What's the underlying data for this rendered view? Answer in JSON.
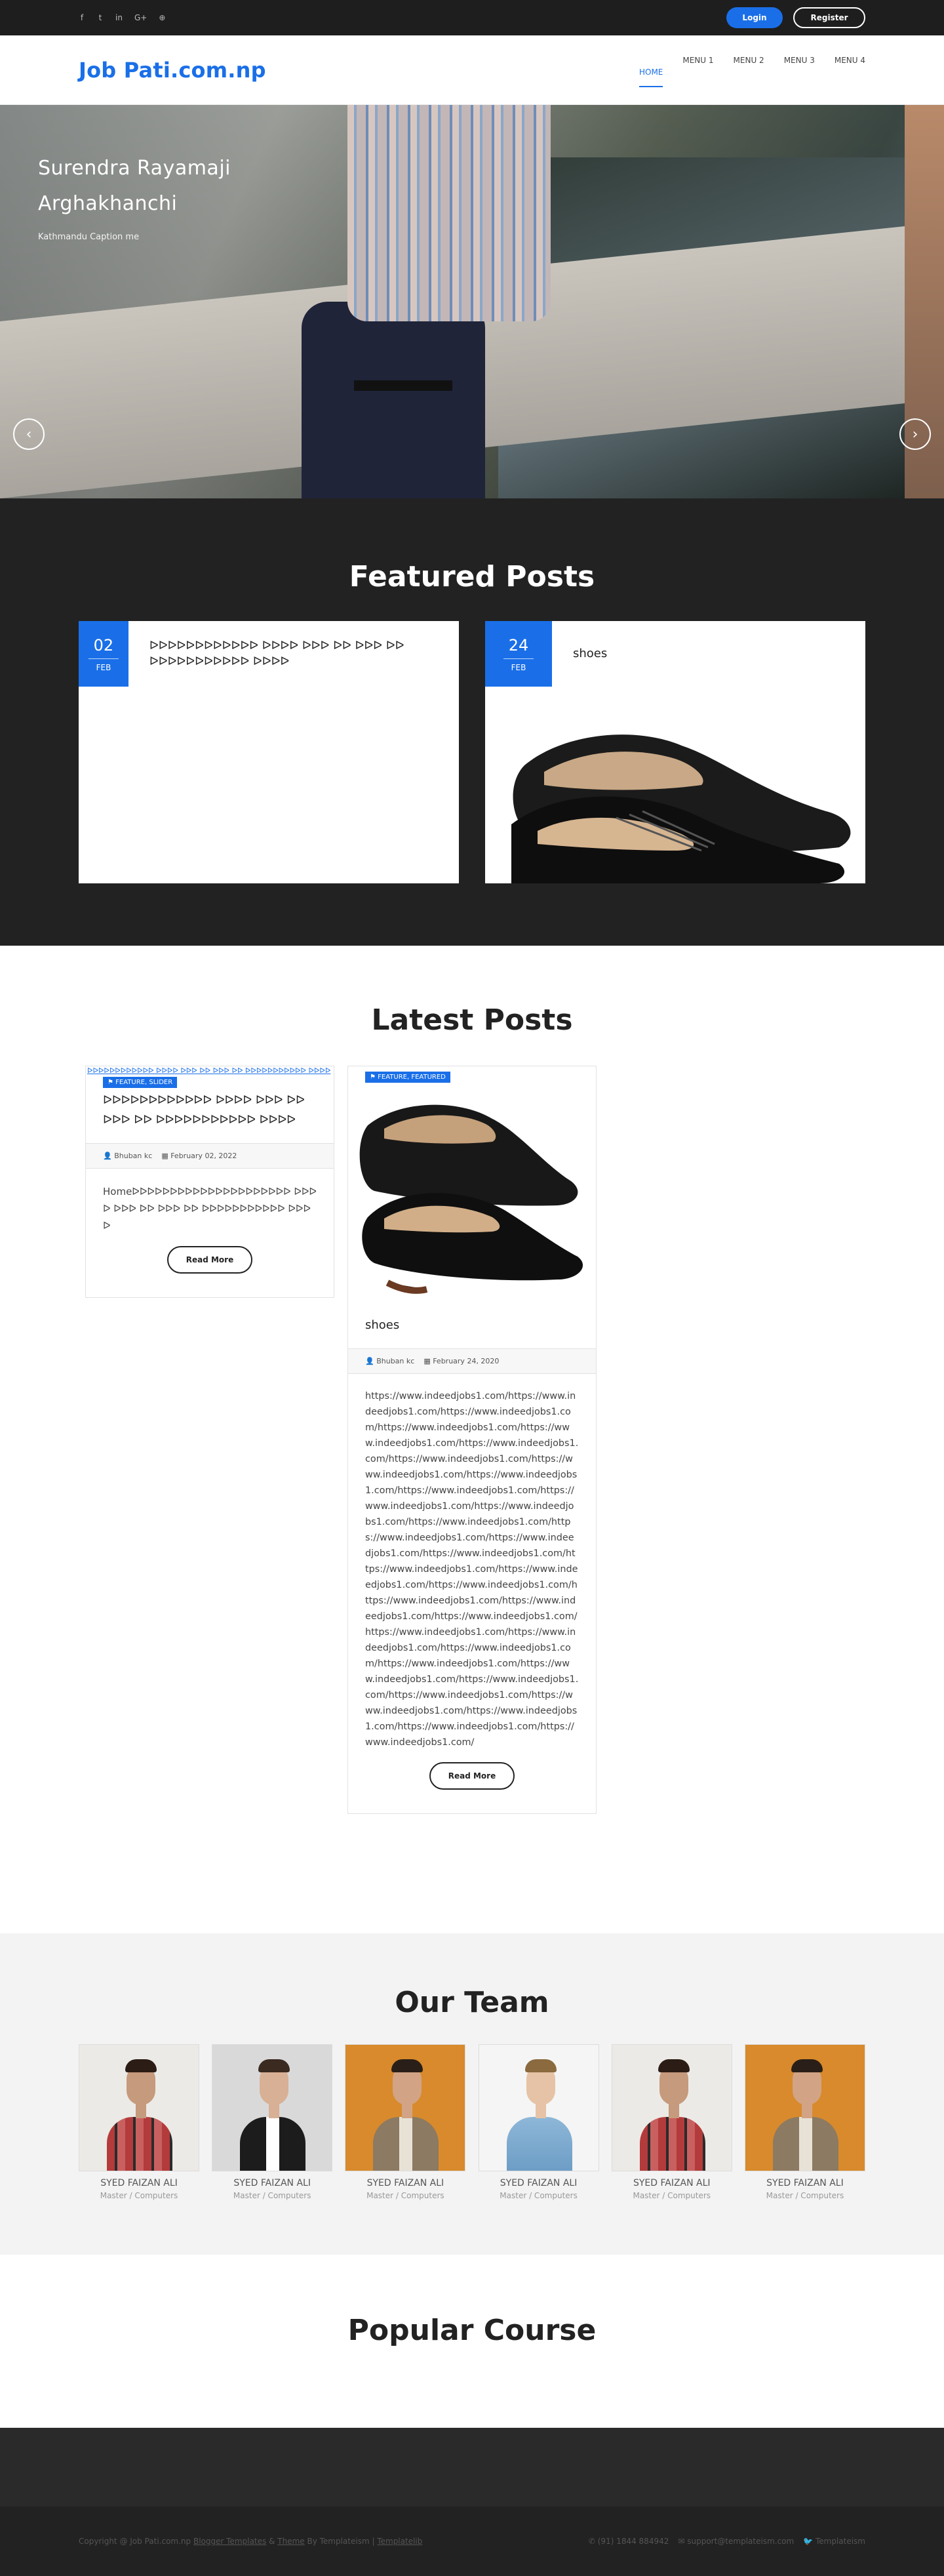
{
  "topbar": {
    "social_icons": [
      "facebook-icon",
      "twitter-icon",
      "linkedin-icon",
      "google-plus-icon",
      "pinterest-icon"
    ],
    "social_glyphs": [
      "f",
      "t",
      "in",
      "G+",
      "⊕"
    ],
    "login_label": "Login",
    "register_label": "Register"
  },
  "header": {
    "logo": "Job Pati.com.np",
    "nav": [
      "HOME",
      "MENU 1",
      "MENU 2",
      "MENU 3",
      "MENU 4"
    ]
  },
  "hero": {
    "title_line1": "Surendra Rayamaji",
    "title_line2": "Arghakhanchi",
    "subtitle": "Kathmandu Caption me",
    "prev": "‹",
    "next": "›"
  },
  "featured": {
    "title": "Featured Posts",
    "posts": [
      {
        "day": "02",
        "month": "FEB",
        "title": "ᐅᐅᐅᐅᐅᐅᐅᐅᐅᐅᐅᐅ ᐅᐅᐅᐅ ᐅᐅᐅ ᐅᐅ ᐅᐅᐅ ᐅᐅ ᐅᐅᐅᐅᐅᐅᐅᐅᐅᐅᐅ ᐅᐅᐅᐅ"
      },
      {
        "day": "24",
        "month": "FEB",
        "title": "shoes"
      }
    ]
  },
  "latest": {
    "title": "Latest Posts",
    "posts": [
      {
        "broken_img_alt": "ᐅᐅᐅᐅᐅᐅᐅᐅᐅᐅᐅᐅ ᐅᐅᐅᐅ ᐅᐅᐅ ᐅᐅ ᐅᐅᐅ ᐅᐅ ᐅᐅᐅᐅᐅᐅᐅᐅᐅᐅᐅ ᐅᐅᐅᐅ",
        "tags": "FEATURE, SLIDER",
        "title": "ᐅᐅᐅᐅᐅᐅᐅᐅᐅᐅᐅᐅ ᐅᐅᐅᐅ ᐅᐅᐅ ᐅᐅ ᐅᐅᐅ ᐅᐅ ᐅᐅᐅᐅᐅᐅᐅᐅᐅᐅᐅ ᐅᐅᐅᐅ",
        "author": "Bhuban kc",
        "date": "February 02, 2022",
        "excerpt": "Homeᐅᐅᐅᐅᐅᐅᐅᐅᐅᐅᐅᐅᐅᐅᐅᐅᐅᐅᐅᐅᐅ ᐅᐅᐅᐅ ᐅᐅᐅ ᐅᐅ ᐅᐅᐅ ᐅᐅ ᐅᐅᐅᐅᐅᐅᐅᐅᐅᐅᐅ ᐅᐅᐅᐅ",
        "read_more": "Read More"
      },
      {
        "tags": "FEATURE, FEATURED",
        "title": "shoes",
        "author": "Bhuban kc",
        "date": "February 24, 2020",
        "excerpt": "https://www.indeedjobs1.com/https://www.indeedjobs1.com/https://www.indeedjobs1.com/https://www.indeedjobs1.com/https://www.indeedjobs1.com/https://www.indeedjobs1.com/https://www.indeedjobs1.com/https://www.indeedjobs1.com/https://www.indeedjobs1.com/https://www.indeedjobs1.com/https://www.indeedjobs1.com/https://www.indeedjobs1.com/https://www.indeedjobs1.com/https://www.indeedjobs1.com/https://www.indeedjobs1.com/https://www.indeedjobs1.com/https://www.indeedjobs1.com/https://www.indeedjobs1.com/https://www.indeedjobs1.com/https://www.indeedjobs1.com/https://www.indeedjobs1.com/https://www.indeedjobs1.com/https://www.indeedjobs1.com/https://www.indeedjobs1.com/https://www.indeedjobs1.com/https://www.indeedjobs1.com/https://www.indeedjobs1.com/https://www.indeedjobs1.com/https://www.indeedjobs1.com/https://www.indeedjobs1.com/https://www.indeedjobs1.com/https://www.indeedjobs1.com/https://www.indeedjobs1.com/",
        "read_more": "Read More"
      }
    ]
  },
  "team": {
    "title": "Our Team",
    "members": [
      {
        "name": "SYED FAIZAN ALI",
        "role": "Master / Computers",
        "tone": "beard"
      },
      {
        "name": "SYED FAIZAN ALI",
        "role": "Master / Computers",
        "tone": "suit"
      },
      {
        "name": "SYED FAIZAN ALI",
        "role": "Master / Computers",
        "tone": "orange"
      },
      {
        "name": "SYED FAIZAN ALI",
        "role": "Master / Computers",
        "tone": "glasses"
      },
      {
        "name": "SYED FAIZAN ALI",
        "role": "Master / Computers",
        "tone": "beard"
      },
      {
        "name": "SYED FAIZAN ALI",
        "role": "Master / Computers",
        "tone": "orange"
      }
    ]
  },
  "popular": {
    "title": "Popular Course"
  },
  "footer": {
    "copyright_prefix": "Copyright @ Job Pati.com.np",
    "link1": "Blogger Templates",
    "amp": " & ",
    "link2": "Theme",
    "by": " By Templateism | ",
    "link3": "Templatelib",
    "phone": "(91) 1844 884942",
    "email": "support@templateism.com",
    "twitter": "Templateism"
  },
  "colors": {
    "accent": "#1a6fe8",
    "dark": "#222222",
    "topbar": "#1e1e1e",
    "light_section": "#f3f3f3"
  }
}
